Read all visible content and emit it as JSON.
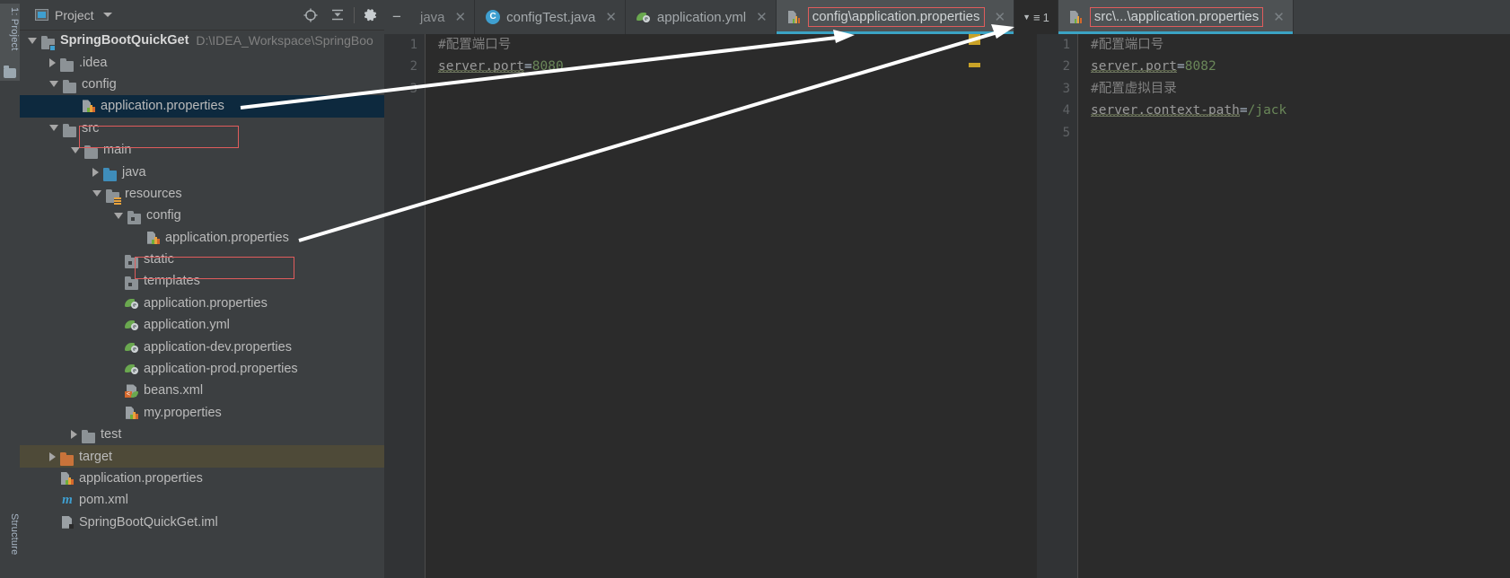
{
  "toolstrip": {
    "project_label": "1: Project",
    "structure_label": "Structure",
    "project_icon": "project-window-icon",
    "folder_icon": "folder-icon"
  },
  "panel": {
    "title": "Project",
    "dropdown_icon": "chevron-down-icon",
    "tools": [
      {
        "name": "locate-icon",
        "label": ""
      },
      {
        "name": "collapse-all-icon",
        "label": ""
      },
      {
        "name": "gear-icon",
        "label": ""
      },
      {
        "name": "minimize-icon",
        "label": "−"
      }
    ]
  },
  "tree": [
    {
      "indent": 0,
      "arrow": "open",
      "icon": "module-folder",
      "label": "SpringBootQuickGet",
      "bold": true,
      "path": "D:\\IDEA_Workspace\\SpringBoo",
      "state": "normal"
    },
    {
      "indent": 1,
      "arrow": "closed",
      "icon": "folder",
      "label": ".idea",
      "bold": false,
      "path": "",
      "state": "normal"
    },
    {
      "indent": 1,
      "arrow": "open",
      "icon": "folder",
      "label": "config",
      "bold": false,
      "path": "",
      "state": "normal"
    },
    {
      "indent": 2,
      "arrow": "none",
      "icon": "properties",
      "label": "application.properties",
      "bold": false,
      "path": "",
      "state": "selected-blue"
    },
    {
      "indent": 1,
      "arrow": "open",
      "icon": "folder",
      "label": "src",
      "bold": false,
      "path": "",
      "state": "normal"
    },
    {
      "indent": 2,
      "arrow": "open",
      "icon": "folder",
      "label": "main",
      "bold": false,
      "path": "",
      "state": "normal"
    },
    {
      "indent": 3,
      "arrow": "closed",
      "icon": "folder-blue",
      "label": "java",
      "bold": false,
      "path": "",
      "state": "normal"
    },
    {
      "indent": 3,
      "arrow": "open",
      "icon": "folder-res",
      "label": "resources",
      "bold": false,
      "path": "",
      "state": "normal"
    },
    {
      "indent": 4,
      "arrow": "open",
      "icon": "folder-dot",
      "label": "config",
      "bold": false,
      "path": "",
      "state": "normal"
    },
    {
      "indent": 5,
      "arrow": "none",
      "icon": "properties",
      "label": "application.properties",
      "bold": false,
      "path": "",
      "state": "normal"
    },
    {
      "indent": 4,
      "arrow": "none",
      "icon": "folder-dot",
      "label": "static",
      "bold": false,
      "path": "",
      "state": "normal"
    },
    {
      "indent": 4,
      "arrow": "none",
      "icon": "folder-dot",
      "label": "templates",
      "bold": false,
      "path": "",
      "state": "normal"
    },
    {
      "indent": 4,
      "arrow": "none",
      "icon": "spring",
      "label": "application.properties",
      "bold": false,
      "path": "",
      "state": "normal"
    },
    {
      "indent": 4,
      "arrow": "none",
      "icon": "spring",
      "label": "application.yml",
      "bold": false,
      "path": "",
      "state": "normal"
    },
    {
      "indent": 4,
      "arrow": "none",
      "icon": "spring",
      "label": "application-dev.properties",
      "bold": false,
      "path": "",
      "state": "normal"
    },
    {
      "indent": 4,
      "arrow": "none",
      "icon": "spring",
      "label": "application-prod.properties",
      "bold": false,
      "path": "",
      "state": "normal"
    },
    {
      "indent": 4,
      "arrow": "none",
      "icon": "xml",
      "label": "beans.xml",
      "bold": false,
      "path": "",
      "state": "normal"
    },
    {
      "indent": 4,
      "arrow": "none",
      "icon": "properties",
      "label": "my.properties",
      "bold": false,
      "path": "",
      "state": "normal"
    },
    {
      "indent": 2,
      "arrow": "closed",
      "icon": "folder",
      "label": "test",
      "bold": false,
      "path": "",
      "state": "normal"
    },
    {
      "indent": 1,
      "arrow": "closed",
      "icon": "folder-orange",
      "label": "target",
      "bold": false,
      "path": "",
      "state": "selected-olive"
    },
    {
      "indent": 1,
      "arrow": "none",
      "icon": "properties",
      "label": "application.properties",
      "bold": false,
      "path": "",
      "state": "normal"
    },
    {
      "indent": 1,
      "arrow": "none",
      "icon": "maven",
      "label": "pom.xml",
      "bold": false,
      "path": "",
      "state": "normal"
    },
    {
      "indent": 1,
      "arrow": "none",
      "icon": "iml",
      "label": "SpringBootQuickGet.iml",
      "bold": false,
      "path": "",
      "state": "normal"
    }
  ],
  "tabs": [
    {
      "icon": "minimize-icon",
      "label": "−",
      "kind": "minus",
      "active": false,
      "closable": false
    },
    {
      "icon": "java-file-icon",
      "label": "java",
      "kind": "clipped",
      "active": false,
      "closable": true
    },
    {
      "icon": "class-icon",
      "label": "configTest.java",
      "kind": "tab",
      "active": false,
      "closable": true
    },
    {
      "icon": "spring-icon",
      "label": "application.yml",
      "kind": "tab",
      "active": false,
      "closable": true
    },
    {
      "icon": "properties-icon",
      "label": "config\\application.properties",
      "kind": "tab",
      "active": true,
      "closable": true,
      "highlighted": true
    },
    {
      "icon": "tab-group-icon",
      "label": "1",
      "kind": "group",
      "active": false,
      "closable": false
    },
    {
      "icon": "properties-icon",
      "label": "src\\...\\application.properties",
      "kind": "tab",
      "active": true,
      "closable": true,
      "highlighted": true
    }
  ],
  "editor_left": {
    "file": "config\\application.properties",
    "line_numbers": [
      "1",
      "2",
      "3"
    ],
    "lines": [
      {
        "type": "comment",
        "text": "#配置端口号"
      },
      {
        "type": "property",
        "key": "server.port",
        "eq": "=",
        "value": "8080"
      },
      {
        "type": "empty",
        "text": ""
      }
    ]
  },
  "editor_right": {
    "file": "src\\...\\application.properties",
    "line_numbers": [
      "1",
      "2",
      "3",
      "4",
      "5"
    ],
    "lines": [
      {
        "type": "comment",
        "text": "#配置端口号"
      },
      {
        "type": "property",
        "key": "server.port",
        "eq": "=",
        "value": "8082"
      },
      {
        "type": "comment",
        "text": "#配置虚拟目录"
      },
      {
        "type": "property",
        "key": "server.context-path",
        "eq": "=",
        "value": "/jack"
      },
      {
        "type": "empty",
        "text": ""
      }
    ]
  },
  "colors": {
    "panel_bg": "#3c3f41",
    "editor_bg": "#2b2b2b",
    "gutter_bg": "#313335",
    "tab_active_bg": "#4e5254",
    "tab_underline": "#3ba3c4",
    "selection_blue": "#0d293e",
    "selection_olive": "#4e4a38",
    "highlight_red": "#e05c5c",
    "string_green": "#6a8759",
    "comment_gray": "#808080",
    "marker_yellow": "#c9a227",
    "annotation_white": "#ffffff"
  },
  "annotations": {
    "arrow1": "arrow-config-properties-to-left-editor",
    "arrow2": "arrow-src-config-properties-to-right-editor"
  }
}
